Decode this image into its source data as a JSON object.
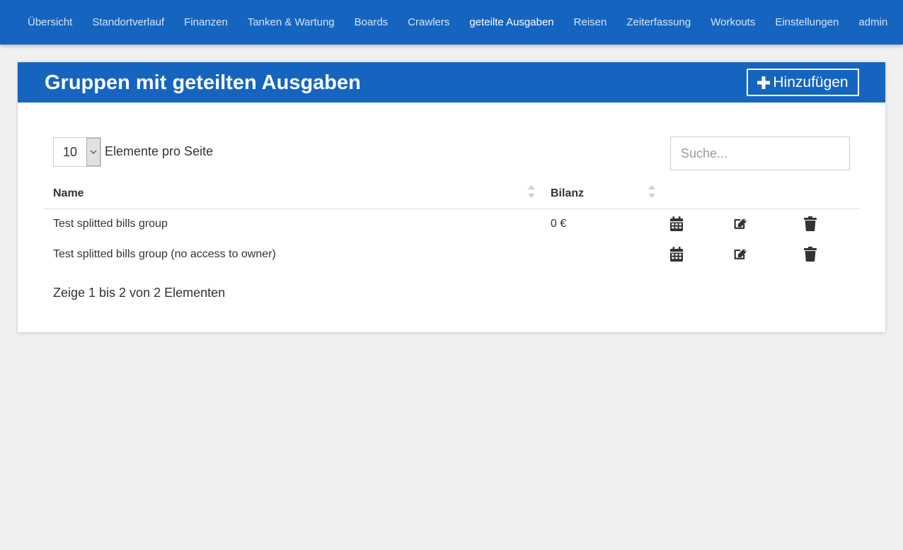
{
  "nav": {
    "items": [
      {
        "label": "Übersicht"
      },
      {
        "label": "Standortverlauf"
      },
      {
        "label": "Finanzen"
      },
      {
        "label": "Tanken & Wartung"
      },
      {
        "label": "Boards"
      },
      {
        "label": "Crawlers"
      },
      {
        "label": "geteilte Ausgaben"
      },
      {
        "label": "Reisen"
      },
      {
        "label": "Zeiterfassung"
      },
      {
        "label": "Workouts"
      },
      {
        "label": "Einstellungen"
      },
      {
        "label": "admin"
      }
    ],
    "active_label": "geteilte Ausgaben"
  },
  "card": {
    "title": "Gruppen mit geteilten Ausgaben",
    "add_label": "Hinzufügen",
    "add_icon": "plus-icon"
  },
  "controls": {
    "page_size": "10",
    "per_page_label": "Elemente pro Seite",
    "search_placeholder": "Suche...",
    "search_value": ""
  },
  "table": {
    "columns": [
      {
        "label": "Name"
      },
      {
        "label": "Bilanz"
      }
    ],
    "rows": [
      {
        "name": "Test splitted bills group",
        "balance": "0 €"
      },
      {
        "name": "Test splitted bills group (no access to owner)",
        "balance": ""
      }
    ],
    "row_action_icons": [
      "calendar-icon",
      "edit-icon",
      "trash-icon"
    ]
  },
  "pager": {
    "info": "Zeige 1 bis 2 von 2 Elementen"
  },
  "colors": {
    "primary": "#1565c0",
    "background": "#f0f0f0",
    "text": "#333333"
  }
}
